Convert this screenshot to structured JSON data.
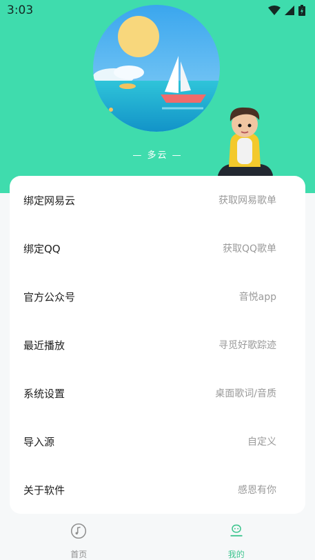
{
  "status_bar": {
    "time": "3:03"
  },
  "header": {
    "weather": "— 多云 —",
    "background_color": "#3fdcad"
  },
  "menu": [
    {
      "label": "绑定网易云",
      "hint": "获取网易歌单"
    },
    {
      "label": "绑定QQ",
      "hint": "获取QQ歌单"
    },
    {
      "label": "官方公众号",
      "hint": "音悦app"
    },
    {
      "label": "最近播放",
      "hint": "寻觅好歌踪迹"
    },
    {
      "label": "系统设置",
      "hint": "桌面歌词/音质"
    },
    {
      "label": "导入源",
      "hint": "自定义"
    },
    {
      "label": "关于软件",
      "hint": "感恩有你"
    }
  ],
  "bottom_nav": {
    "items": [
      {
        "label": "首页",
        "icon": "music-disc-icon",
        "active": false
      },
      {
        "label": "我的",
        "icon": "profile-icon",
        "active": true
      }
    ],
    "active_color": "#3ec58f",
    "inactive_color": "#8e8e8e"
  }
}
